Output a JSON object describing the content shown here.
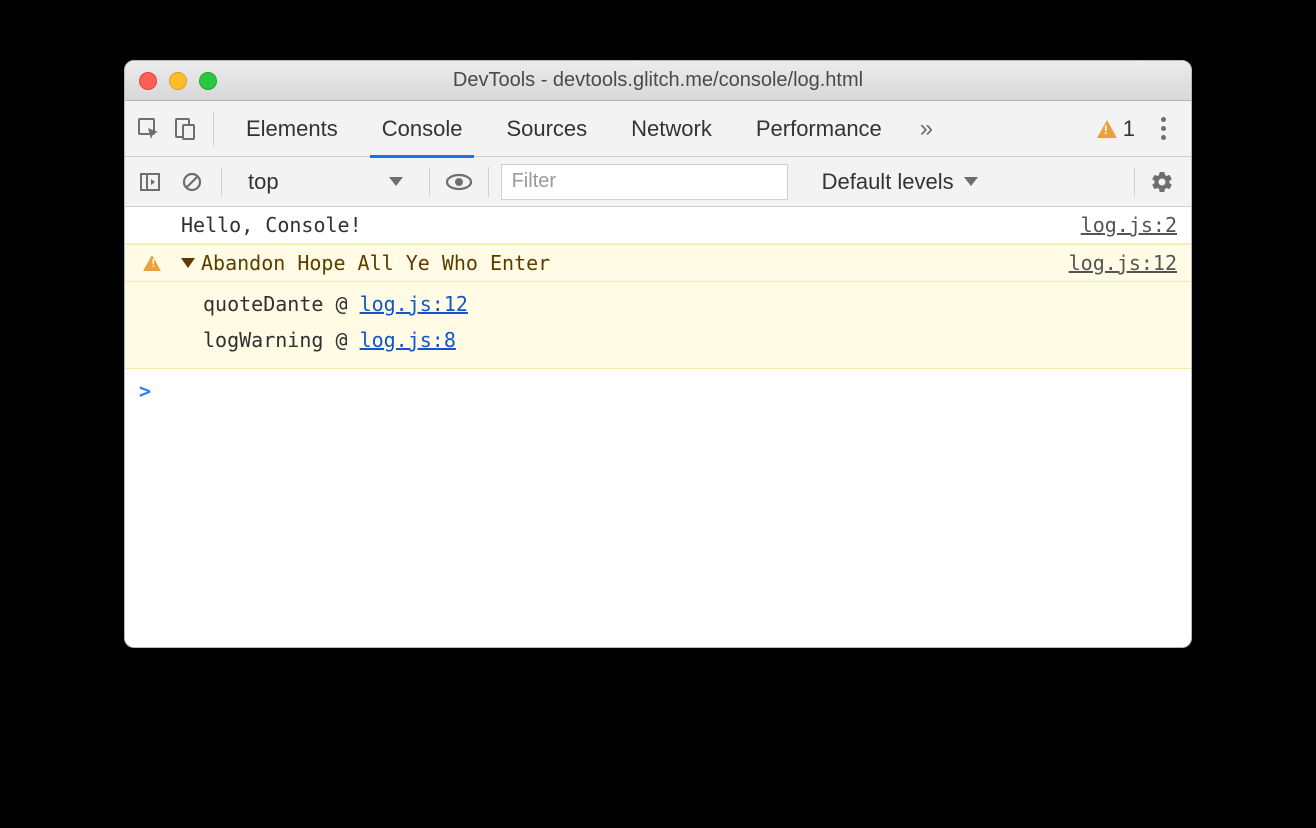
{
  "window": {
    "title": "DevTools - devtools.glitch.me/console/log.html"
  },
  "tabs": {
    "elements": "Elements",
    "console": "Console",
    "sources": "Sources",
    "network": "Network",
    "performance": "Performance"
  },
  "overflow_glyph": "»",
  "warning_count": "1",
  "toolbar": {
    "context": "top",
    "filter_placeholder": "Filter",
    "levels": "Default levels"
  },
  "logs": {
    "row0": {
      "msg": "Hello, Console!",
      "src": "log.js:2"
    },
    "row1": {
      "msg": "Abandon Hope All Ye Who Enter",
      "src": "log.js:12"
    }
  },
  "stack": {
    "frame0": {
      "fn": "quoteDante",
      "at": "@",
      "link": "log.js:12"
    },
    "frame1": {
      "fn": "logWarning",
      "at": "@",
      "link": "log.js:8"
    }
  },
  "prompt": ">"
}
